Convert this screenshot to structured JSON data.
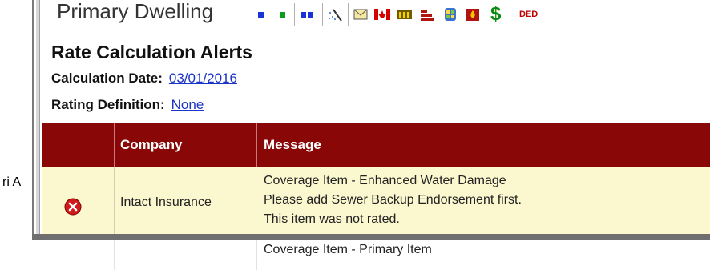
{
  "window": {
    "left_clip_text": "ri A"
  },
  "toolbar": {
    "title": "Primary Dwelling",
    "icons": [
      "square-small-blue-icon",
      "square-small-green-icon",
      "two-squares-icon",
      "sparkle-icon",
      "envelope-icon",
      "canada-flag-icon",
      "receipt-icon",
      "brick-wall-icon",
      "shield-icon",
      "fire-icon",
      "dollar-icon"
    ],
    "dollar_label": "$",
    "ded_label": "DED"
  },
  "alerts": {
    "title": "Rate Calculation Alerts",
    "calc_date_label": "Calculation Date:",
    "calc_date_value": "03/01/2016",
    "rating_def_label": "Rating Definition:",
    "rating_def_value": "None"
  },
  "table": {
    "headers": [
      "",
      "Company",
      "Message"
    ],
    "rows": [
      {
        "icon": "error-icon",
        "company": "Intact Insurance",
        "message_lines": [
          "Coverage Item - Enhanced Water Damage",
          "Please add Sewer Backup Endorsement first.",
          "This item was not rated."
        ]
      },
      {
        "icon": "",
        "company": "",
        "message_lines": [
          "Coverage Item - Primary Item"
        ]
      }
    ]
  },
  "colors": {
    "header_bg": "#8a0707",
    "row_bg": "#fbf7cf",
    "link": "#1a34c7",
    "error": "#d11a1a"
  }
}
